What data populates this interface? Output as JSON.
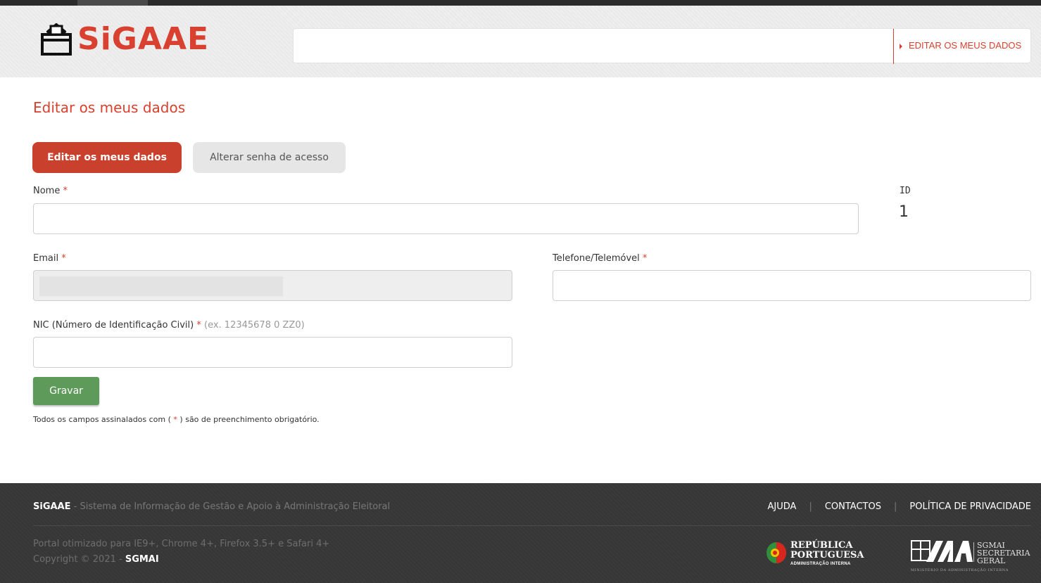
{
  "app": {
    "logo_text": "SiGAAE",
    "breadcrumb": "EDITAR OS MEUS DADOS",
    "page_title": "Editar os meus dados"
  },
  "tabs": [
    {
      "label": "Editar os meus dados",
      "active": true
    },
    {
      "label": "Alterar senha de acesso",
      "active": false
    }
  ],
  "form": {
    "required_mark": "*",
    "name": {
      "label": "Nome",
      "value": ""
    },
    "id": {
      "label": "ID",
      "value": "1"
    },
    "email": {
      "label": "Email",
      "value": "",
      "disabled": true
    },
    "phone": {
      "label": "Telefone/Telemóvel",
      "value": ""
    },
    "nic": {
      "label": "NIC (Número de Identificação Civil)",
      "hint": "(ex. 12345678 0 ZZ0)",
      "value": ""
    },
    "save_label": "Gravar",
    "note_before": "Todos os campos assinalados com ( ",
    "note_after": " ) são de preenchimento obrigatório."
  },
  "footer": {
    "brand": "SiGAAE",
    "brand_desc": " - Sistema de Informação de Gestão e Apoio à Administração Eleitoral",
    "links": [
      "AJUDA",
      "CONTACTOS",
      "POLÍTICA DE PRIVACIDADE"
    ],
    "separator": "|",
    "compat": "Portal otimizado para IE9+, Chrome 4+, Firefox 3.5+ e Safari 4+",
    "copyright_prefix": "Copyright © 2021 - ",
    "copyright_owner": "SGMAI",
    "rp_line1": "REPÚBLICA",
    "rp_line2": "PORTUGUESA",
    "rp_sub": "ADMINISTRAÇÃO INTERNA",
    "sg_line1": "SGMAI",
    "sg_line2": "SECRETARIA",
    "sg_line3": "GERAL",
    "sg_sub": "MINISTÉRIO DA ADMINISTRAÇÃO INTERNA"
  },
  "colors": {
    "accent": "#d8412f",
    "save": "#5e9a5a",
    "footer_bg": "#383838"
  }
}
